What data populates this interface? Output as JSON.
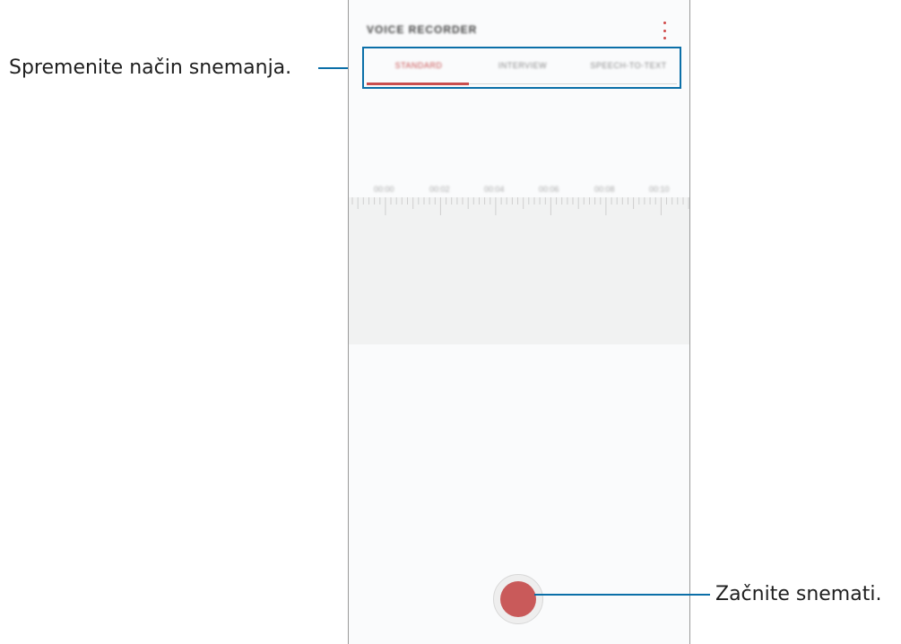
{
  "callouts": {
    "change_mode": "Spremenite način snemanja.",
    "start_recording": "Začnite snemati."
  },
  "app": {
    "title": "VOICE RECORDER",
    "more_icon": "more-vertical-icon",
    "tabs": [
      {
        "label": "STANDARD",
        "active": true
      },
      {
        "label": "INTERVIEW",
        "active": false
      },
      {
        "label": "SPEECH-TO-TEXT",
        "active": false
      }
    ],
    "timeline": [
      "00:00",
      "00:02",
      "00:04",
      "00:06",
      "00:08",
      "00:10"
    ],
    "record_button_icon": "record-icon"
  },
  "colors": {
    "accent": "#c84e4e",
    "callout_line": "#0b6fa8",
    "record": "#c95a5a"
  }
}
